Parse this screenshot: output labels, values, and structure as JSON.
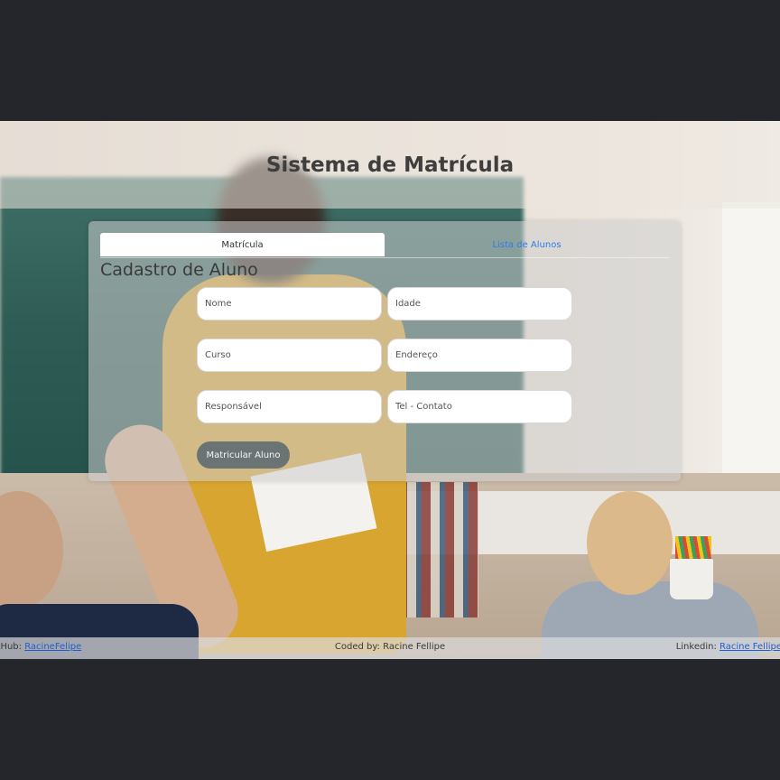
{
  "header": {
    "title": "Sistema de Matrícula"
  },
  "tabs": [
    {
      "label": "Matrícula",
      "active": true
    },
    {
      "label": "Lista de Alunos",
      "active": false
    }
  ],
  "form": {
    "title": "Cadastro de Aluno",
    "fields": {
      "nome": "Nome",
      "idade": "Idade",
      "curso": "Curso",
      "endereco": "Endereço",
      "responsavel": "Responsável",
      "telefone": "Tel - Contato"
    },
    "submit_label": "Matricular Aluno"
  },
  "footer": {
    "github_label": "GitHub: ",
    "github_link": "RacineFelipe",
    "credit": "Coded by: Racine Fellipe",
    "linkedin_label": "Linkedin: ",
    "linkedin_link": "Racine Fellipe"
  },
  "colors": {
    "page_background": "#25262b",
    "tab_link": "#2f7ce8",
    "submit_button": "#6b7474"
  }
}
